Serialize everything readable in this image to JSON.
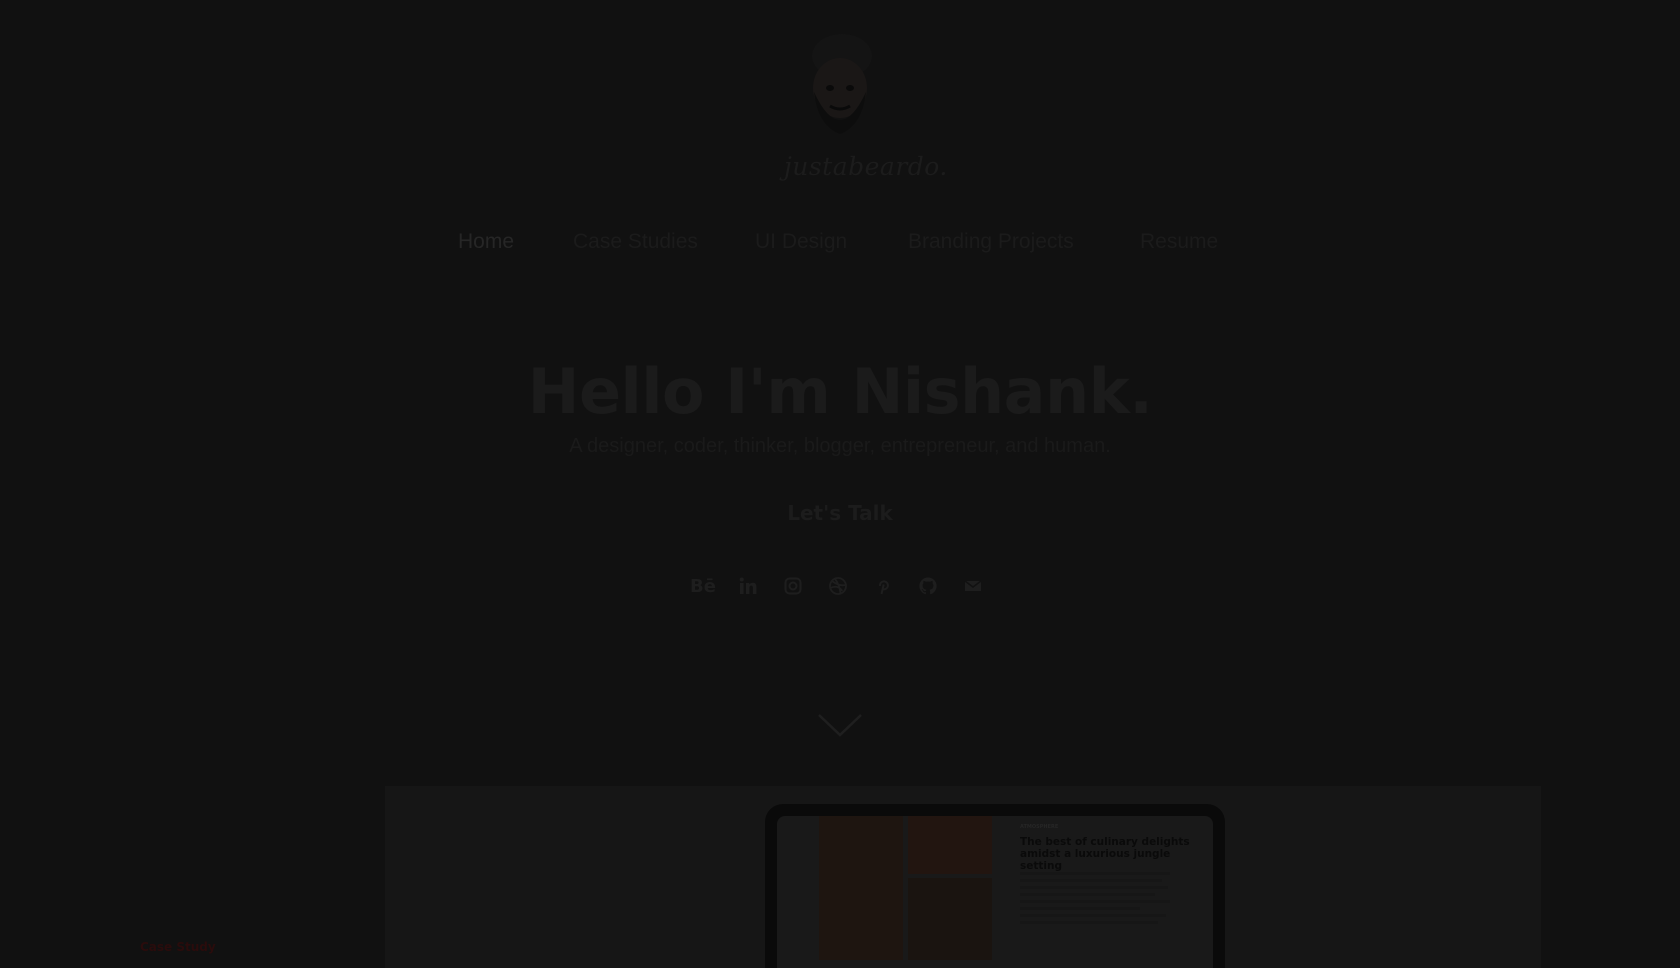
{
  "logo": {
    "text": "justabeardo."
  },
  "nav": {
    "items": [
      {
        "label": "Home",
        "active": true
      },
      {
        "label": "Case Studies",
        "active": false
      },
      {
        "label": "UI Design",
        "active": false
      },
      {
        "label": "Branding Projects",
        "active": false
      },
      {
        "label": "Resume",
        "active": false
      }
    ]
  },
  "hero": {
    "title": "Hello I'm Nishank.",
    "subtitle": "A designer, coder, thinker, blogger, entrepreneur, and human.",
    "cta_label": "Let's Talk"
  },
  "social": [
    {
      "icon": "behance-icon",
      "glyph": "Bē"
    },
    {
      "icon": "linkedin-icon"
    },
    {
      "icon": "instagram-icon"
    },
    {
      "icon": "dribbble-icon"
    },
    {
      "icon": "pinterest-icon"
    },
    {
      "icon": "github-icon"
    },
    {
      "icon": "mail-icon"
    }
  ],
  "case_study": {
    "label": "Case Study",
    "preview_kicker": "ATMOSPHERE",
    "preview_title": "The best of culinary delights amidst a luxurious jungle setting"
  },
  "colors": {
    "background": "#111111",
    "case_label": "#2a0c0c"
  }
}
